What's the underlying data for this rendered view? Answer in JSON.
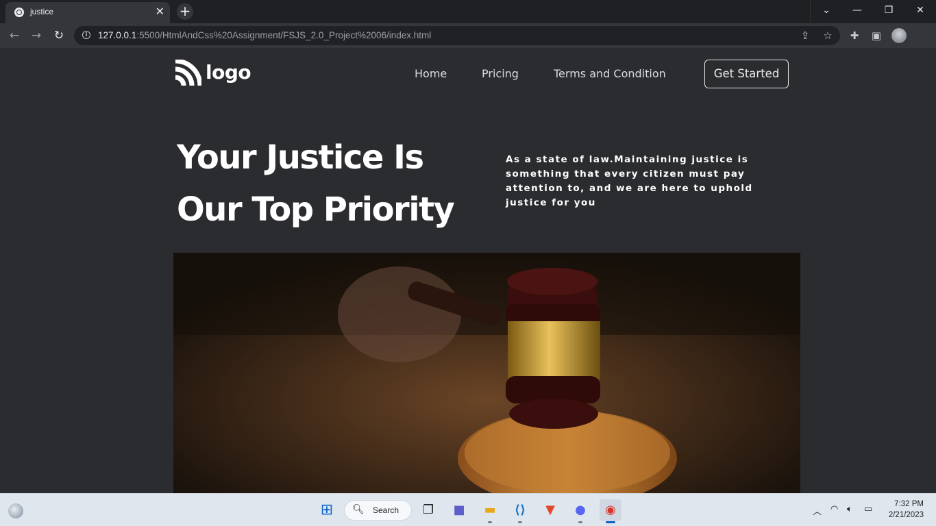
{
  "browser": {
    "tab_title": "justice",
    "tab_close": "✕",
    "new_tab": "+",
    "url_host": "127.0.0.1",
    "url_rest": ":5500/HtmlAndCss%20Assignment/FSJS_2.0_Project%2006/index.html"
  },
  "site": {
    "logo_text": "logo",
    "nav": [
      "Home",
      "Pricing",
      "Terms and Condition"
    ],
    "cta_label": "Get Started",
    "hero_title_line1": "Your Justice Is",
    "hero_title_line2": "Our Top Priority",
    "hero_description": "As a state of law.Maintaining justice is something that every citizen must pay attention to, and we are here to uphold justice for you"
  },
  "taskbar": {
    "search_label": "Search",
    "time": "7:32 PM",
    "date": "2/21/2023"
  }
}
